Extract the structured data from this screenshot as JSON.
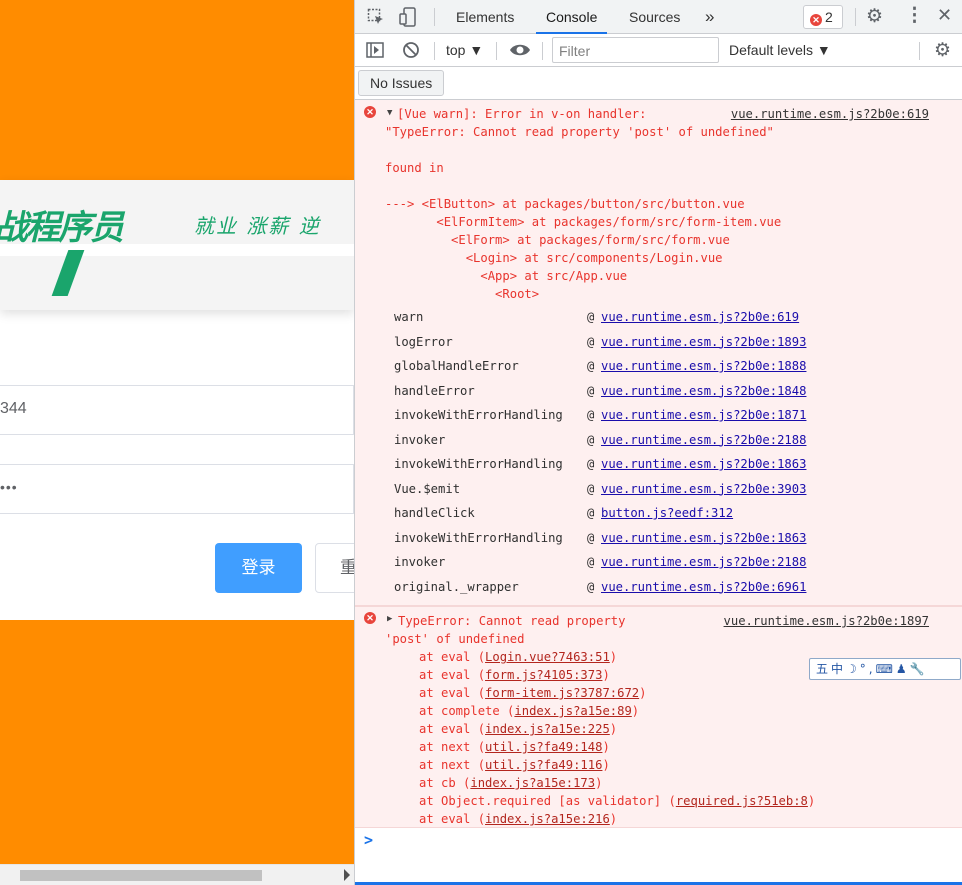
{
  "page": {
    "logo_text": "战程序员",
    "slogan": "就业 涨薪 逆",
    "username_value": "344",
    "password_value": "•••",
    "login_button": "登录",
    "reset_button": "重"
  },
  "devtools": {
    "tabs": [
      "Elements",
      "Console",
      "Sources"
    ],
    "active_tab": "Console",
    "more_tabs": "»",
    "error_count": "2",
    "context": "top ▼",
    "filter_placeholder": "Filter",
    "levels": "Default levels ▼",
    "no_issues": "No Issues"
  },
  "console": {
    "msg1": {
      "header": "[Vue warn]: Error in v-on handler:",
      "source": "vue.runtime.esm.js?2b0e:619",
      "lines": [
        "\"TypeError: Cannot read property 'post' of undefined\"",
        "",
        "found in",
        "",
        "---> <ElButton> at packages/button/src/button.vue",
        "       <ElFormItem> at packages/form/src/form-item.vue",
        "         <ElForm> at packages/form/src/form.vue",
        "           <Login> at src/components/Login.vue",
        "             <App> at src/App.vue",
        "               <Root>"
      ],
      "stack": [
        {
          "name": "warn",
          "link": "vue.runtime.esm.js?2b0e:619"
        },
        {
          "name": "logError",
          "link": "vue.runtime.esm.js?2b0e:1893"
        },
        {
          "name": "globalHandleError",
          "link": "vue.runtime.esm.js?2b0e:1888"
        },
        {
          "name": "handleError",
          "link": "vue.runtime.esm.js?2b0e:1848"
        },
        {
          "name": "invokeWithErrorHandling",
          "link": "vue.runtime.esm.js?2b0e:1871"
        },
        {
          "name": "invoker",
          "link": "vue.runtime.esm.js?2b0e:2188"
        },
        {
          "name": "invokeWithErrorHandling",
          "link": "vue.runtime.esm.js?2b0e:1863"
        },
        {
          "name": "Vue.$emit",
          "link": "vue.runtime.esm.js?2b0e:3903"
        },
        {
          "name": "handleClick",
          "link": "button.js?eedf:312"
        },
        {
          "name": "invokeWithErrorHandling",
          "link": "vue.runtime.esm.js?2b0e:1863"
        },
        {
          "name": "invoker",
          "link": "vue.runtime.esm.js?2b0e:2188"
        },
        {
          "name": "original._wrapper",
          "link": "vue.runtime.esm.js?2b0e:6961"
        }
      ]
    },
    "msg2": {
      "header": "TypeError: Cannot read property",
      "source": "vue.runtime.esm.js?2b0e:1897",
      "line2": "'post' of undefined",
      "trace": [
        {
          "prefix": "at eval (",
          "link": "Login.vue?7463:51",
          "suffix": ")"
        },
        {
          "prefix": "at eval (",
          "link": "form.js?4105:373",
          "suffix": ")"
        },
        {
          "prefix": "at eval (",
          "link": "form-item.js?3787:672",
          "suffix": ")"
        },
        {
          "prefix": "at complete (",
          "link": "index.js?a15e:89",
          "suffix": ")"
        },
        {
          "prefix": "at eval (",
          "link": "index.js?a15e:225",
          "suffix": ")"
        },
        {
          "prefix": "at next (",
          "link": "util.js?fa49:148",
          "suffix": ")"
        },
        {
          "prefix": "at next (",
          "link": "util.js?fa49:116",
          "suffix": ")"
        },
        {
          "prefix": "at cb (",
          "link": "index.js?a15e:173",
          "suffix": ")"
        },
        {
          "prefix": "at Object.required [as validator] (",
          "link": "required.js?51eb:8",
          "suffix": ")"
        },
        {
          "prefix": "at eval (",
          "link": "index.js?a15e:216",
          "suffix": ")"
        }
      ]
    },
    "prompt": ">"
  },
  "ime": "五中☽°,⌨♟🔧",
  "colors": {
    "page_bg": "#ff8c00",
    "accent": "#1a73e8",
    "error_red": "#e8342d",
    "login_btn": "#409eff"
  }
}
